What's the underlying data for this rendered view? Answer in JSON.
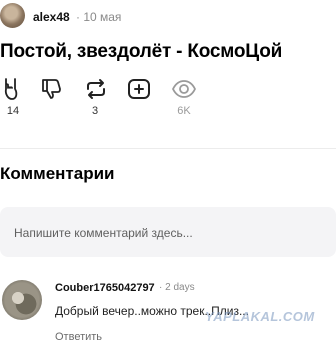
{
  "post": {
    "author": "alex48",
    "date": "· 10 мая",
    "title": "Постой, звездолёт - КосмоЦой"
  },
  "actions": [
    {
      "name": "like",
      "icon": "rock-hand-icon",
      "count": "14"
    },
    {
      "name": "dislike",
      "icon": "thumbs-down-icon",
      "count": ""
    },
    {
      "name": "repost",
      "icon": "repost-icon",
      "count": "3"
    },
    {
      "name": "add",
      "icon": "plus-square-icon",
      "count": ""
    },
    {
      "name": "views",
      "icon": "eye-icon",
      "count": "6K"
    }
  ],
  "comments_section": {
    "heading": "Комментарии",
    "input_placeholder": "Напишите комментарий здесь..."
  },
  "comment": {
    "author": "Couber1765042797",
    "date": "· 2 days",
    "text": "Добрый вечер..можно трек..Плиз...",
    "reply_label": "Ответить"
  },
  "watermark": "YAPLAKAL.COM"
}
